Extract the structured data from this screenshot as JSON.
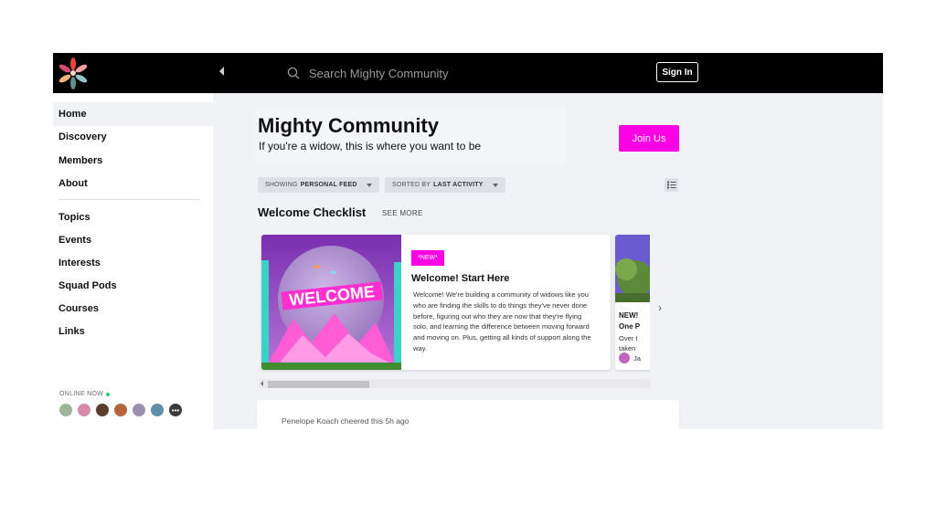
{
  "topbar": {
    "search_placeholder": "Search Mighty Community",
    "signin_label": "Sign In"
  },
  "sidebar": {
    "primary": [
      {
        "label": "Home",
        "active": true
      },
      {
        "label": "Discovery"
      },
      {
        "label": "Members"
      },
      {
        "label": "About"
      }
    ],
    "secondary": [
      {
        "label": "Topics"
      },
      {
        "label": "Events"
      },
      {
        "label": "Interests"
      },
      {
        "label": "Squad Pods"
      },
      {
        "label": "Courses"
      },
      {
        "label": "Links"
      }
    ],
    "online_label": "ONLINE NOW",
    "online_count_avatars": 6
  },
  "main": {
    "title": "Mighty Community",
    "subtitle": "If you're a widow, this is where you want to be",
    "join_label": "Join Us",
    "filter_feed_prefix": "SHOWING",
    "filter_feed_value": "PERSONAL FEED",
    "filter_sort_prefix": "SORTED BY",
    "filter_sort_value": "LAST ACTIVITY",
    "section_title": "Welcome Checklist",
    "see_more": "SEE MORE",
    "card": {
      "badge": "*NEW*",
      "image_text": "WELCOME",
      "title": "Welcome! Start Here",
      "body": "Welcome! We're building a community of widows like you who are finding the skills to do things they've never done before, figuring out who they are now that they're flying solo, and learning the difference between moving forward and moving on. Plus, getting all kinds of support along the way."
    },
    "card2": {
      "line1": "NEW!",
      "line2": "One P",
      "line3": "Over t",
      "line4": "taken",
      "author": "Ja"
    },
    "feed_activity": "Penelope Koach cheered this 5h ago"
  },
  "colors": {
    "accent": "#ff00e6",
    "topbar": "#000000",
    "background": "#f1f2f6"
  }
}
